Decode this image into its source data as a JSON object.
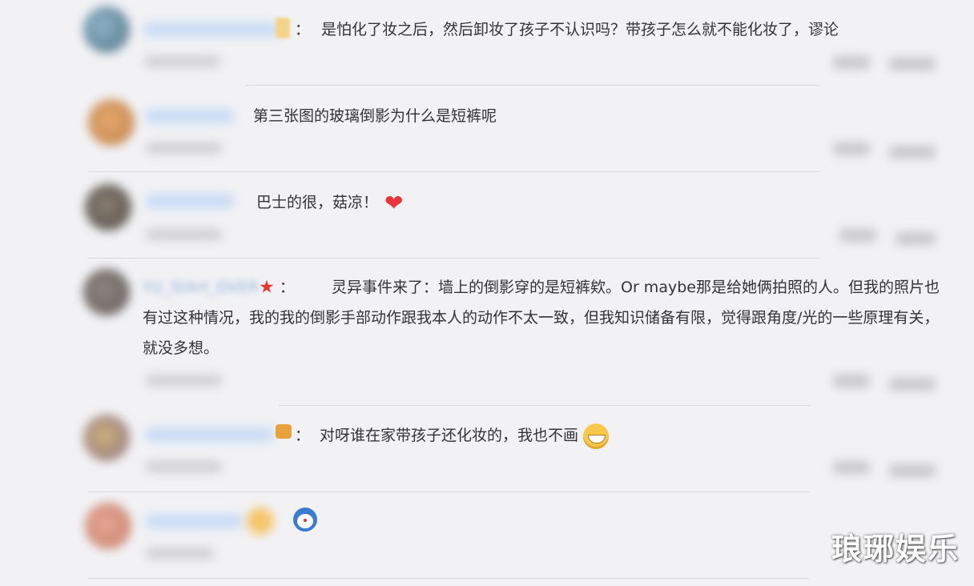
{
  "comments": [
    {
      "text": "是怕化了妆之后，然后卸妆了孩子不认识吗？带孩子怎么就不能化妆了，谬论",
      "prefix": "："
    },
    {
      "text": "第三张图的玻璃倒影为什么是短裤呢"
    },
    {
      "text": "巴士的很，菇凉！"
    },
    {
      "username": "YU_StArt_OVER",
      "prefix": "：",
      "text": "灵异事件来了：墙上的倒影穿的是短裤欸。Or maybe那是给她俩拍照的人。但我的照片也有过这种情况，我的我的倒影手部动作跟我本人的动作不太一致，但我知识储备有限，觉得跟角度/光的一些原理有关，就没多想。"
    },
    {
      "text": "对呀谁在家带孩子还化妆的，我也不画",
      "prefix": "："
    },
    {
      "text": ""
    }
  ],
  "watermark": "琅琊娱乐",
  "colors": {
    "background": "#f2f2f5",
    "text": "#333333",
    "username_blue": "#c9dcf5",
    "heart": "#e8343a"
  }
}
